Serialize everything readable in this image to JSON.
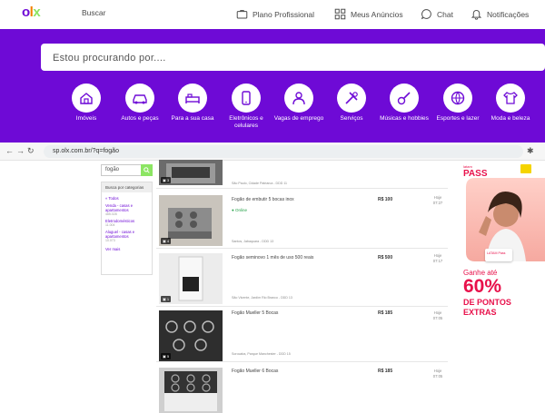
{
  "header": {
    "logo": {
      "o": "o",
      "l": "l",
      "x": "x"
    },
    "search_label": "Buscar",
    "links": {
      "plano": "Plano Profissional",
      "anuncios": "Meus Anúncios",
      "chat": "Chat",
      "notificacoes": "Notificações"
    }
  },
  "banner": {
    "search_placeholder": "Estou procurando por....",
    "categories": [
      {
        "label": "Imóveis",
        "icon": "house-icon"
      },
      {
        "label": "Autos e peças",
        "icon": "car-icon"
      },
      {
        "label": "Para a sua casa",
        "icon": "bed-icon"
      },
      {
        "label": "Eletrônicos e celulares",
        "icon": "phone-icon"
      },
      {
        "label": "Vagas de emprego",
        "icon": "person-icon"
      },
      {
        "label": "Serviços",
        "icon": "tools-icon"
      },
      {
        "label": "Músicas e hobbies",
        "icon": "guitar-icon"
      },
      {
        "label": "Esportes e lazer",
        "icon": "ball-icon"
      },
      {
        "label": "Moda e beleza",
        "icon": "shirt-icon"
      }
    ]
  },
  "browser": {
    "url": "sp.olx.com.br/?q=fogão"
  },
  "filter": {
    "query": "fogão",
    "box_title": "Busca por categorias",
    "all": "« Todos",
    "items": [
      {
        "label": "Venda - casas e apartamentos",
        "count": "465.028"
      },
      {
        "label": "Eletrodomésticos",
        "count": "11.004"
      },
      {
        "label": "Aluguel - casas e apartamentos",
        "count": "10.073"
      }
    ],
    "more": "Ver mais"
  },
  "listings": [
    {
      "title": "",
      "price": "",
      "date": "",
      "location": "São Paulo, Cidade Patriarca - DDD 11",
      "photos": "3",
      "online": ""
    },
    {
      "title": "Fogão de embutir 5 bocas inox",
      "price": "R$ 100",
      "date": "Hoje 07:27",
      "location": "Santos, Jabaquara - DDD 13",
      "photos": "4",
      "online": "Online"
    },
    {
      "title": "Fogão seminovo 1 mês de uso 500 reais",
      "price": "R$ 500",
      "date": "Hoje 07:17",
      "location": "São Vicente, Jardim Rio Branco - DDD 13",
      "photos": "1",
      "online": ""
    },
    {
      "title": "Fogão Mueller 5 Bocas",
      "price": "R$ 185",
      "date": "Hoje 07:05",
      "location": "Sorocaba, Parque Manchester - DDD 15",
      "photos": "5",
      "online": ""
    },
    {
      "title": "Fogão Mueller 6 Bocas",
      "price": "R$ 185",
      "date": "Hoje 07:05",
      "location": "",
      "photos": "",
      "online": ""
    }
  ],
  "ad": {
    "brand_small": "latam",
    "brand": "PASS",
    "card": "LATAM Pass",
    "line1": "Ganhe até",
    "big": "60%",
    "line2": "DE PONTOS",
    "line3": "EXTRAS"
  },
  "colors": {
    "purple": "#6e0ad6",
    "orange": "#f28000",
    "green": "#8ce563",
    "ad_red": "#e8114b"
  }
}
